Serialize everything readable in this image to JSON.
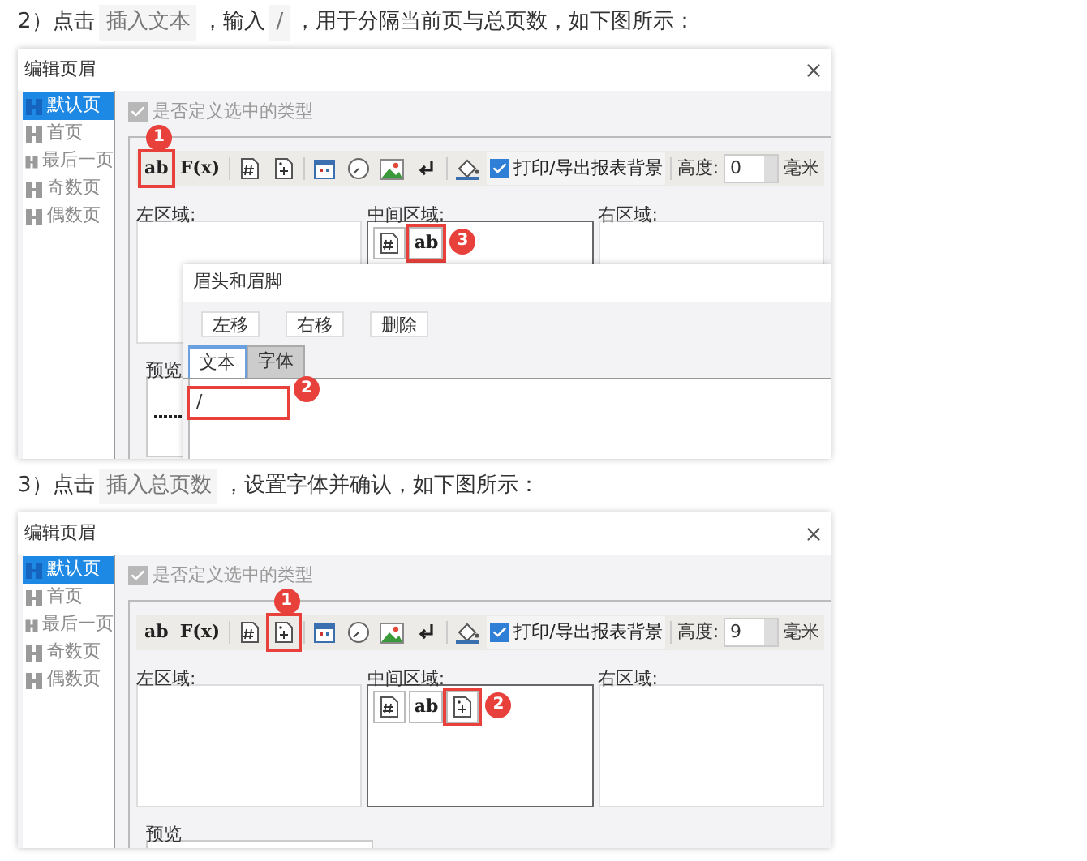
{
  "steps": [
    {
      "segments": [
        {
          "kind": "text",
          "text": "2）点击"
        },
        {
          "kind": "code",
          "text": "插入文本"
        },
        {
          "kind": "text",
          "text": "，输入"
        },
        {
          "kind": "code",
          "text": "/"
        },
        {
          "kind": "text",
          "text": "，用于分隔当前页与总页数，如下图所示："
        }
      ],
      "dialog": {
        "title": "编辑页眉",
        "pages": [
          {
            "label": "默认页",
            "selected": true
          },
          {
            "label": "首页",
            "selected": false
          },
          {
            "label": "最后一页",
            "selected": false
          },
          {
            "label": "奇数页",
            "selected": false
          },
          {
            "label": "偶数页",
            "selected": false
          }
        ],
        "custom_type": {
          "label": "是否定义选中的类型",
          "checked": true
        },
        "tools": [
          {
            "kind": "text",
            "text": "ab",
            "highlighted": true,
            "marker": "1"
          },
          {
            "kind": "text",
            "text": "F(x)",
            "highlighted": false
          },
          {
            "kind": "page-number",
            "highlighted": false
          },
          {
            "kind": "total-pages",
            "highlighted": false
          },
          {
            "kind": "date",
            "highlighted": false
          },
          {
            "kind": "time",
            "highlighted": false
          },
          {
            "kind": "image",
            "highlighted": false
          },
          {
            "kind": "newline",
            "highlighted": false
          },
          {
            "kind": "background",
            "highlighted": false
          }
        ],
        "print_background": {
          "label": "打印/导出报表背景",
          "checked": true
        },
        "height": {
          "label": "高度:",
          "value": "0",
          "unit": "毫米"
        },
        "areas": [
          {
            "label": "左区域:"
          },
          {
            "label": "中间区域:",
            "items": [
              {
                "kind": "page-number",
                "highlighted": false
              },
              {
                "kind": "text",
                "text": "ab",
                "highlighted": true,
                "marker": "3"
              }
            ]
          },
          {
            "label": "右区域:"
          }
        ],
        "preview": {
          "label": "预览"
        },
        "popup": {
          "title": "眉头和眉脚",
          "buttons": [
            "左移",
            "右移",
            "删除"
          ],
          "tabs": [
            {
              "label": "文本",
              "selected": true
            },
            {
              "label": "字体",
              "selected": false
            }
          ],
          "value": "/",
          "highlighted": true,
          "marker": "2"
        }
      }
    },
    {
      "segments": [
        {
          "kind": "text",
          "text": "3）点击"
        },
        {
          "kind": "code",
          "text": "插入总页数"
        },
        {
          "kind": "text",
          "text": "，设置字体并确认，如下图所示："
        }
      ],
      "dialog": {
        "title": "编辑页眉",
        "pages": [
          {
            "label": "默认页",
            "selected": true
          },
          {
            "label": "首页",
            "selected": false
          },
          {
            "label": "最后一页",
            "selected": false
          },
          {
            "label": "奇数页",
            "selected": false
          },
          {
            "label": "偶数页",
            "selected": false
          }
        ],
        "custom_type": {
          "label": "是否定义选中的类型",
          "checked": true
        },
        "tools": [
          {
            "kind": "text",
            "text": "ab",
            "highlighted": false
          },
          {
            "kind": "text",
            "text": "F(x)",
            "highlighted": false
          },
          {
            "kind": "page-number",
            "highlighted": false
          },
          {
            "kind": "total-pages",
            "highlighted": true,
            "marker": "1"
          },
          {
            "kind": "date",
            "highlighted": false
          },
          {
            "kind": "time",
            "highlighted": false
          },
          {
            "kind": "image",
            "highlighted": false
          },
          {
            "kind": "newline",
            "highlighted": false
          },
          {
            "kind": "background",
            "highlighted": false
          }
        ],
        "print_background": {
          "label": "打印/导出报表背景",
          "checked": true
        },
        "height": {
          "label": "高度:",
          "value": "9",
          "unit": "毫米"
        },
        "areas": [
          {
            "label": "左区域:"
          },
          {
            "label": "中间区域:",
            "items": [
              {
                "kind": "page-number",
                "highlighted": false
              },
              {
                "kind": "text",
                "text": "ab",
                "highlighted": false
              },
              {
                "kind": "total-pages",
                "highlighted": true,
                "marker": "2"
              }
            ]
          },
          {
            "label": "右区域:"
          }
        ],
        "preview": {
          "label": "预览"
        }
      }
    }
  ]
}
